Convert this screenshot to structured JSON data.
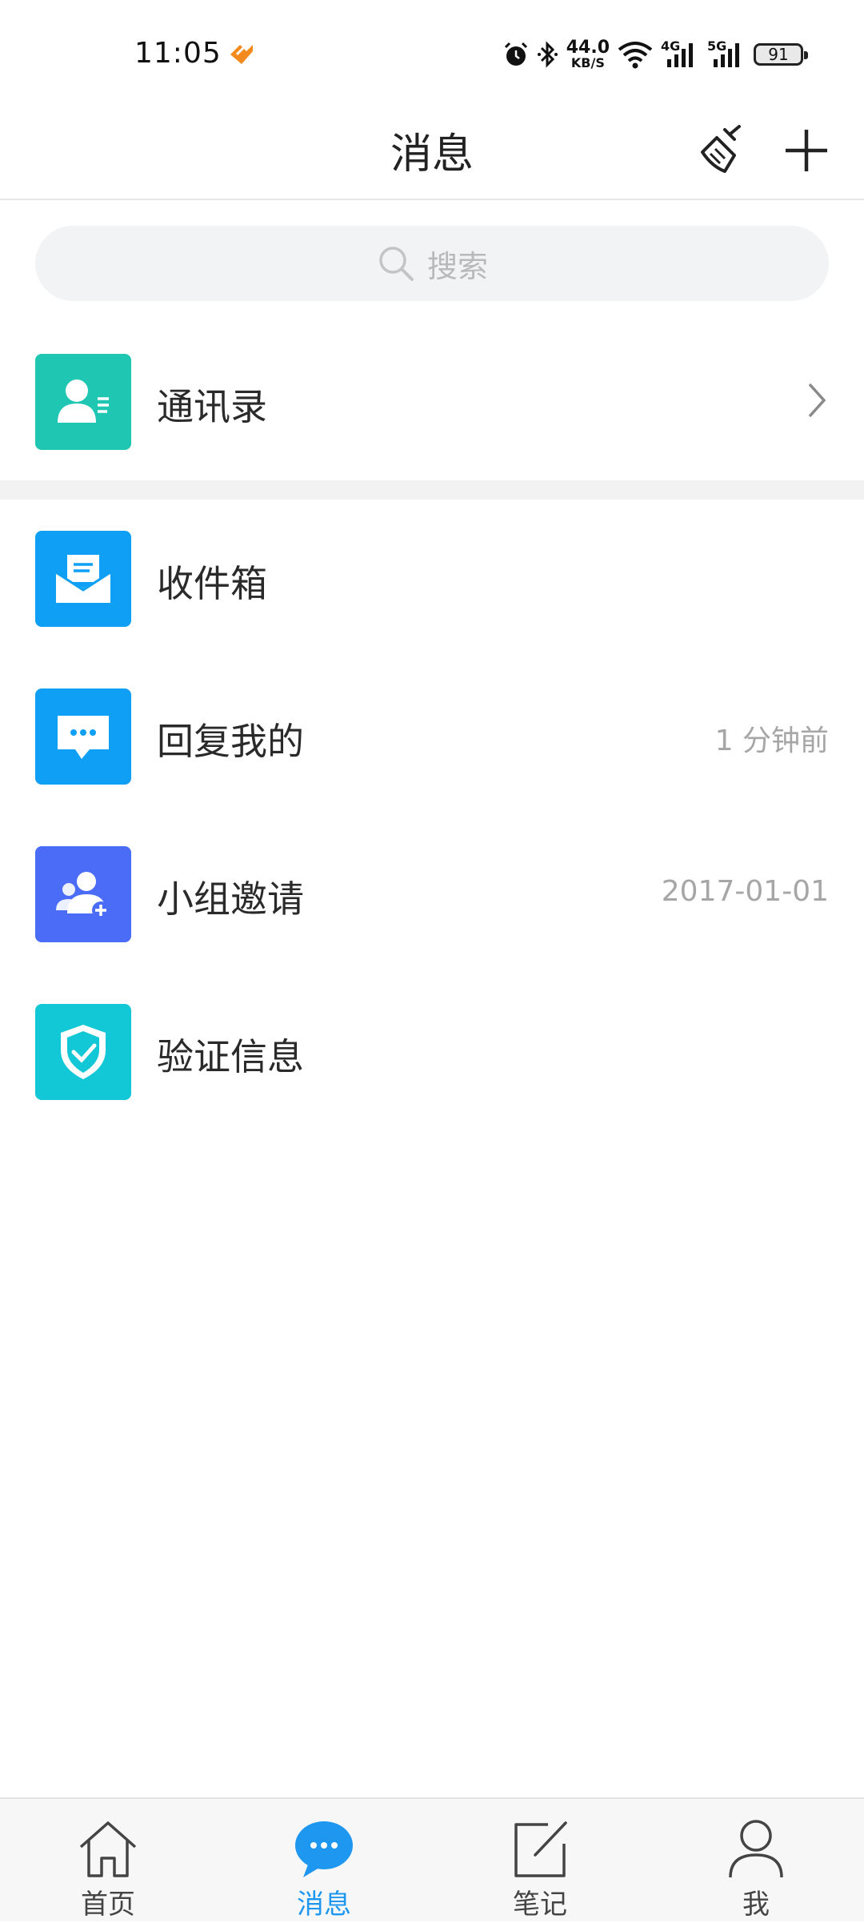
{
  "status_bar": {
    "time": "11:05",
    "net_speed_value": "44.0",
    "net_speed_unit": "KB/S",
    "sim1_label": "4G",
    "sim2_label": "5G",
    "battery": "91"
  },
  "header": {
    "title": "消息",
    "actions": [
      "broom-icon",
      "plus-icon"
    ]
  },
  "search": {
    "placeholder": "搜索"
  },
  "contacts": {
    "label": "通讯录",
    "icon": "contact-card-icon",
    "color": "#1fc7b2"
  },
  "messages": [
    {
      "label": "收件箱",
      "meta": "",
      "icon": "inbox-envelope-icon",
      "color": "#0fa0f5"
    },
    {
      "label": "回复我的",
      "meta": "1 分钟前",
      "icon": "chat-bubble-icon",
      "color": "#0fa0f5"
    },
    {
      "label": "小组邀请",
      "meta": "2017-01-01",
      "icon": "group-add-icon",
      "color": "#4a6cf7"
    },
    {
      "label": "验证信息",
      "meta": "",
      "icon": "shield-check-icon",
      "color": "#13c8d6"
    }
  ],
  "bottom_nav": {
    "items": [
      {
        "label": "首页",
        "icon": "home-icon"
      },
      {
        "label": "消息",
        "icon": "message-bubble-icon",
        "active": true
      },
      {
        "label": "笔记",
        "icon": "edit-note-icon"
      },
      {
        "label": "我",
        "icon": "person-icon"
      }
    ],
    "active_color": "#1e97f0"
  }
}
